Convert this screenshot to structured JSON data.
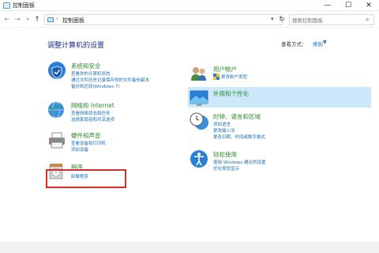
{
  "window": {
    "title": "控制面板",
    "minimize": "—",
    "maximize": "☐",
    "close": "✕"
  },
  "nav": {
    "back": "←",
    "forward": "→",
    "recent": "▾",
    "up": "↑",
    "address_sep": "›",
    "breadcrumb": "控制面板",
    "address_dropdown": "▾",
    "refresh": "↻",
    "search_placeholder": "搜索控制面板",
    "search_icon": "⌕"
  },
  "main": {
    "title": "调整计算机的设置",
    "view_by_label": "查看方式：",
    "view_by_value": "类别",
    "view_by_chevron": "▼"
  },
  "categories_left": [
    {
      "name": "系统和安全",
      "icon": "shield-icon",
      "links": [
        "查看你的计算机状态",
        "通过文件历史记录保存你的文件备份副本",
        "备份和还原(Windows 7)"
      ]
    },
    {
      "name": "网络和 Internet",
      "icon": "globe-icon",
      "links": [
        "查看网络状态和任务",
        "选择家庭组和共享选项"
      ]
    },
    {
      "name": "硬件和声音",
      "icon": "printer-icon",
      "links": [
        "查看设备和打印机",
        "添加设备"
      ]
    },
    {
      "name": "程序",
      "icon": "programs-icon",
      "links": [
        "卸载程序"
      ]
    }
  ],
  "categories_right": [
    {
      "name": "用户帐户",
      "icon": "users-icon",
      "links": [
        "更改帐户类型"
      ]
    },
    {
      "name": "外观和个性化",
      "icon": "appearance-icon",
      "links": []
    },
    {
      "name": "时钟、语言和区域",
      "icon": "clock-icon",
      "links": [
        "添加语言",
        "更改输入法",
        "更改日期、时间或数字格式"
      ]
    },
    {
      "name": "轻松使用",
      "icon": "accessibility-icon",
      "links": [
        "使用 Windows 建议的设置",
        "优化视觉显示"
      ]
    }
  ],
  "colors": {
    "category_heading": "#2e8b2e",
    "link": "#1a6fb5",
    "title": "#1e3287",
    "highlight": "#d0312d",
    "selected_bg": "#cde8fb"
  }
}
